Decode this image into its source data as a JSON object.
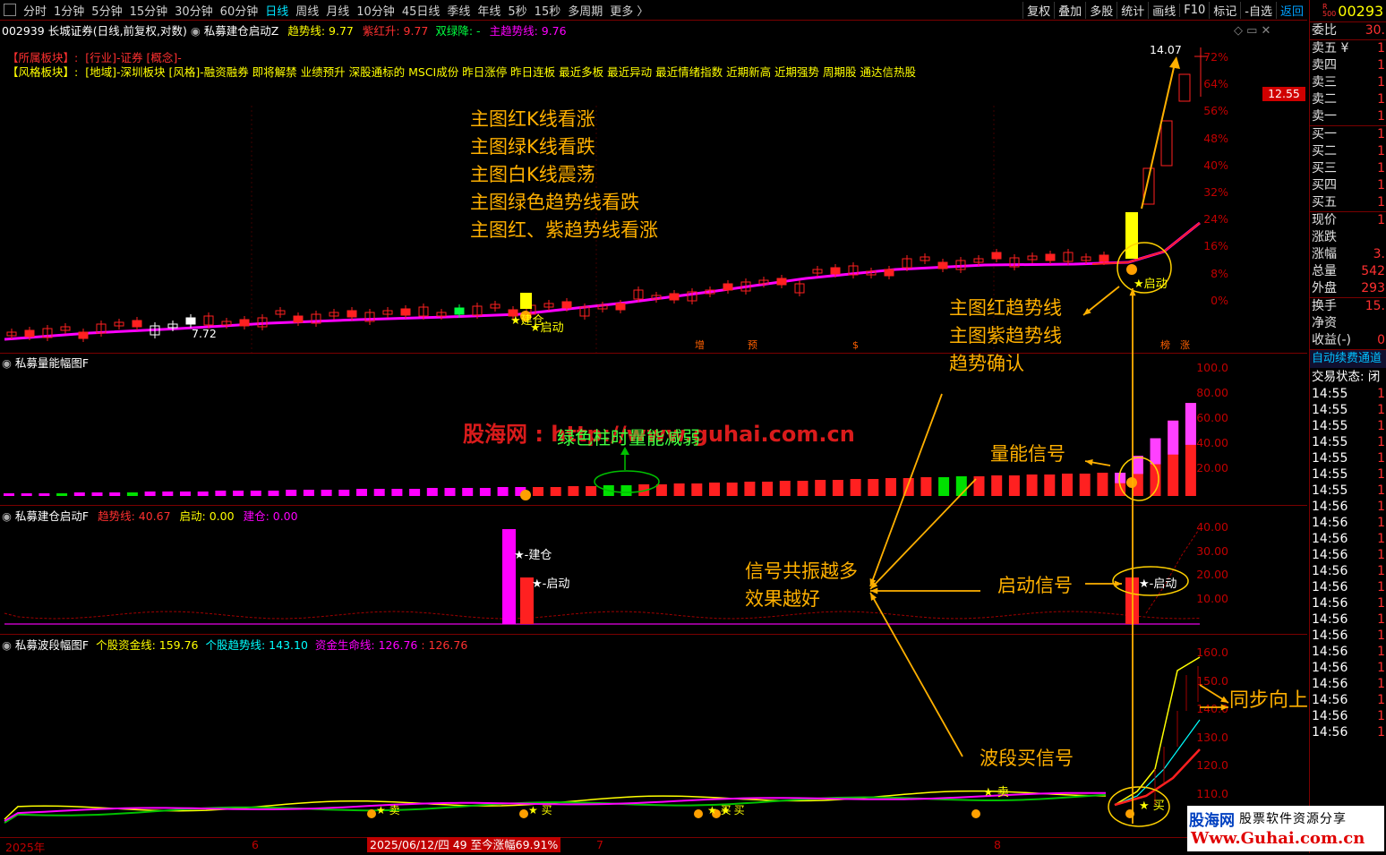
{
  "toolbar": {
    "timeframes": [
      "分时",
      "1分钟",
      "5分钟",
      "15分钟",
      "30分钟",
      "60分钟",
      "日线",
      "周线",
      "月线",
      "10分钟",
      "45日线",
      "季线",
      "年线",
      "5秒",
      "15秒",
      "多周期",
      "更多 〉"
    ],
    "active_index": 6,
    "tools": [
      "复权",
      "叠加",
      "多股",
      "统计",
      "画线",
      "F10",
      "标记",
      "-自选",
      "返回"
    ]
  },
  "main_chart": {
    "stock_header": "002939 长城证券(日线,前复权,对数)",
    "indicator_name": "私募建仓启动Z",
    "trend_line_label": "趋势线: 9.77",
    "red_up_label": "紫红升: 9.77",
    "green_down_label": "双绿降: -",
    "main_trend_label": "主趋势线: 9.76",
    "sector_label": "【所属板块】:",
    "sector_value": "[行业]-证券 [概念]-",
    "style_label": "【风格板块】:",
    "style_value": "[地域]-深圳板块 [风格]-融资融券 即将解禁 业绩预升 深股通标的 MSCI成份 昨日涨停 昨日连板 最近多板 最近异动 最近情绪指数 近期新高 近期强势 周期股 通达信热股",
    "high_price_label": "14.07",
    "low_price_label": "7.72",
    "current_price_tag": "12.55",
    "axis_ticks": [
      "72%",
      "64%",
      "56%",
      "48%",
      "40%",
      "32%",
      "24%",
      "16%",
      "8%",
      "0%"
    ],
    "signal_jiancang": "建仓",
    "signal_qidong": "★启动",
    "event_markers": [
      "增",
      "预",
      "$",
      "榜",
      "涨"
    ],
    "annotations": [
      "主图红K线看涨",
      "主图绿K线看跌",
      "主图白K线震荡",
      "主图绿色趋势线看跌",
      "主图红、紫趋势线看涨"
    ],
    "trend_note": [
      "主图红趋势线",
      "主图紫趋势线",
      "趋势确认"
    ],
    "colors": {
      "up": "#ff2020",
      "down": "#00ff40",
      "neutral": "#ffffff",
      "trend": "#ff00ff",
      "highlight": "#ffff00",
      "annotation": "#ffb000"
    }
  },
  "volume_panel": {
    "title": "私募量能幅图F",
    "axis_ticks": [
      "100.0",
      "80.00",
      "60.00",
      "40.00",
      "20.00"
    ],
    "watermark": "股海网 : http://www.guhai.com.cn",
    "note": "绿色柱时量能减弱",
    "signal_note": "量能信号"
  },
  "build_panel": {
    "title": "私募建仓启动F",
    "trend_label": "趋势线: 40.67",
    "start_label": "启动: 0.00",
    "build_label": "建仓: 0.00",
    "axis_ticks": [
      "40.00",
      "30.00",
      "20.00",
      "10.00"
    ],
    "signal_jiancang": "★-建仓",
    "signal_qidong": "★-启动",
    "signal_qidong2": "★-启动",
    "resonance_note": [
      "信号共振越多",
      "效果越好"
    ],
    "start_note": "启动信号"
  },
  "wave_panel": {
    "title": "私募波段幅图F",
    "fund_line": "个股资金线: 159.76",
    "trend_line": "个股趋势线: 143.10",
    "life_line": "资金生命线: 126.76",
    "life_line_2": ": 126.76",
    "axis_ticks": [
      "160.0",
      "150.0",
      "140.0",
      "130.0",
      "120.0",
      "110.0"
    ],
    "buy_label": "★ 买",
    "sell_label": "★ 卖",
    "sync_note": "同步向上",
    "wave_note": "波段买信号"
  },
  "date_axis": {
    "year": "2025年",
    "m6": "6",
    "m7": "7",
    "m8": "8",
    "cursor_info": "2025/06/12/四 49 至今涨幅69.91%"
  },
  "right_panel": {
    "code": "00293",
    "top_rows": [
      {
        "label": "委比",
        "value": "30."
      },
      {
        "label": "卖五 ¥",
        "value": "1"
      },
      {
        "label": "卖四",
        "value": "1"
      },
      {
        "label": "卖三",
        "value": "1"
      },
      {
        "label": "卖二",
        "value": "1"
      },
      {
        "label": "卖一",
        "value": "1"
      },
      {
        "label": "买一",
        "value": "1"
      },
      {
        "label": "买二",
        "value": "1"
      },
      {
        "label": "买三",
        "value": "1"
      },
      {
        "label": "买四",
        "value": "1"
      },
      {
        "label": "买五",
        "value": "1"
      },
      {
        "label": "现价",
        "value": "1"
      },
      {
        "label": "涨跌",
        "value": ""
      },
      {
        "label": "涨幅",
        "value": "3."
      },
      {
        "label": "总量",
        "value": "542"
      },
      {
        "label": "外盘",
        "value": "293"
      },
      {
        "label": "换手",
        "value": "15."
      },
      {
        "label": "净资",
        "value": ""
      },
      {
        "label": "收益(-)",
        "value": "0"
      }
    ],
    "auto_renew": "自动续费通道",
    "trade_status": "交易状态: 闭",
    "times": [
      "14:55",
      "14:55",
      "14:55",
      "14:55",
      "14:55",
      "14:55",
      "14:55",
      "14:56",
      "14:56",
      "14:56",
      "14:56",
      "14:56",
      "14:56",
      "14:56",
      "14:56",
      "14:56",
      "14:56",
      "14:56",
      "14:56",
      "14:56",
      "14:56",
      "14:56"
    ],
    "watermark_brand": "股海网",
    "watermark_slogan": "股票软件资源分享",
    "watermark_url": "Www.Guhai.com.cn"
  }
}
